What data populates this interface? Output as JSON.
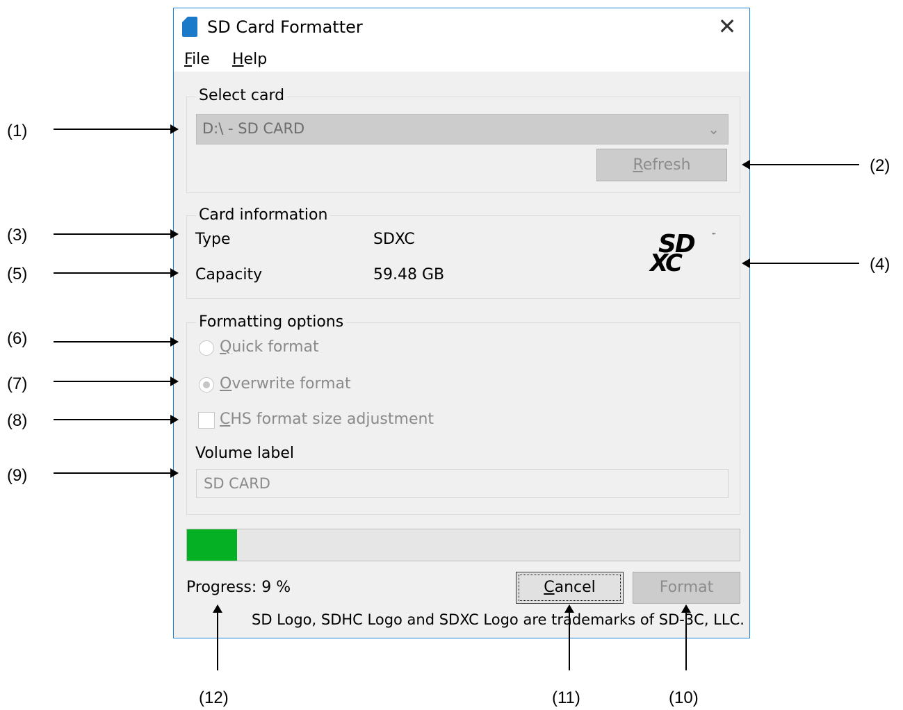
{
  "window": {
    "title": "SD Card Formatter",
    "close_glyph": "✕",
    "icon": "sd-card-icon"
  },
  "menu": {
    "file": {
      "mnemonic": "F",
      "rest": "ile"
    },
    "help": {
      "mnemonic": "H",
      "rest": "elp"
    }
  },
  "select_card": {
    "group_label": "Select card",
    "selected": "D:\\ - SD CARD",
    "arrow": "⌄",
    "refresh": {
      "mnemonic": "R",
      "rest": "efresh"
    }
  },
  "card_info": {
    "group_label": "Card information",
    "type_label": "Type",
    "type_value": "SDXC",
    "capacity_label": "Capacity",
    "capacity_value": "59.48 GB",
    "logo_top": "SD",
    "logo_bottom": "XC",
    "logo_tm": "™"
  },
  "formatting_options": {
    "group_label": "Formatting options",
    "quick": {
      "mnemonic": "Q",
      "rest": "uick format",
      "selected": false
    },
    "overwrite": {
      "mnemonic": "O",
      "rest": "verwrite format",
      "selected": true
    },
    "chs": {
      "mnemonic": "C",
      "rest": "HS format size adjustment",
      "checked": false
    },
    "volume_label_caption": "Volume label",
    "volume_label_value": "SD CARD"
  },
  "progress": {
    "text": "Progress: 9 %",
    "fraction": 0.09,
    "color": "#06b025"
  },
  "buttons": {
    "cancel": {
      "mnemonic": "C",
      "rest": "ancel"
    },
    "format": "Format"
  },
  "footer": "SD Logo, SDHC Logo and SDXC Logo are trademarks of SD-3C, LLC.",
  "annotations": {
    "a1": "(1)",
    "a2": "(2)",
    "a3": "(3)",
    "a4": "(4)",
    "a5": "(5)",
    "a6": "(6)",
    "a7": "(7)",
    "a8": "(8)",
    "a9": "(9)",
    "a10": "(10)",
    "a11": "(11)",
    "a12": "(12)"
  }
}
